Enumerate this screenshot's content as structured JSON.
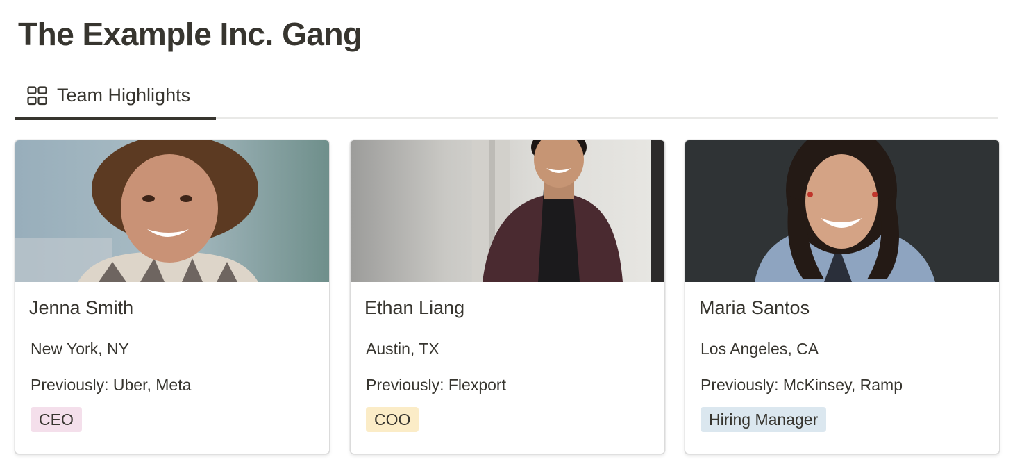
{
  "page": {
    "title": "The Example Inc. Gang"
  },
  "tabs": [
    {
      "label": "Team Highlights",
      "icon": "gallery-icon"
    }
  ],
  "cards": [
    {
      "name": "Jenna Smith",
      "location": "New York, NY",
      "previously": "Previously: Uber, Meta",
      "role": "CEO",
      "role_color": "#f4dfeb"
    },
    {
      "name": "Ethan Liang",
      "location": "Austin, TX",
      "previously": "Previously: Flexport",
      "role": "COO",
      "role_color": "#fbecc7"
    },
    {
      "name": "Maria Santos",
      "location": "Los Angeles, CA",
      "previously": "Previously: McKinsey, Ramp",
      "role": "Hiring Manager",
      "role_color": "#dbe7ef"
    }
  ]
}
